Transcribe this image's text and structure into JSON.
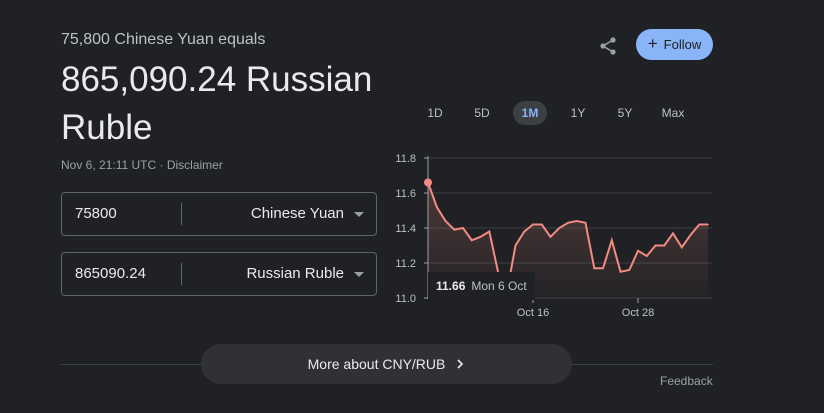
{
  "header": {
    "subtitle": "75,800 Chinese Yuan equals",
    "result": "865,090.24 Russian Ruble",
    "timestamp": "Nov 6, 21:11 UTC",
    "separator": "·",
    "disclaimer": "Disclaimer",
    "follow_label": "Follow",
    "share_icon": "share-icon",
    "follow_color": "#8ab4f8"
  },
  "converter": {
    "from": {
      "amount": "75800",
      "currency": "Chinese Yuan"
    },
    "to": {
      "amount": "865090.24",
      "currency": "Russian Ruble"
    }
  },
  "range_tabs": [
    {
      "label": "1D",
      "active": false
    },
    {
      "label": "5D",
      "active": false
    },
    {
      "label": "1M",
      "active": true
    },
    {
      "label": "1Y",
      "active": false
    },
    {
      "label": "5Y",
      "active": false
    },
    {
      "label": "Max",
      "active": false
    }
  ],
  "tooltip": {
    "value": "11.66",
    "date": "Mon 6 Oct"
  },
  "chart_data": {
    "type": "line",
    "ylabels": [
      "11.8",
      "11.6",
      "11.4",
      "11.2",
      "11.0"
    ],
    "yticks": [
      11.8,
      11.6,
      11.4,
      11.2,
      11.0
    ],
    "ylim": [
      11.0,
      11.8
    ],
    "xlabels": [
      "Oct 16",
      "Oct 28"
    ],
    "xtick_index": [
      12,
      24
    ],
    "values": [
      11.66,
      11.52,
      11.44,
      11.39,
      11.4,
      11.33,
      11.35,
      11.38,
      11.15,
      11.03,
      11.3,
      11.38,
      11.42,
      11.42,
      11.35,
      11.4,
      11.43,
      11.44,
      11.43,
      11.17,
      11.17,
      11.33,
      11.15,
      11.16,
      11.27,
      11.24,
      11.3,
      11.3,
      11.37,
      11.29,
      11.36,
      11.42,
      11.42
    ],
    "highlight_index": 0,
    "line_color": "#f28b82",
    "grid": true
  },
  "footer": {
    "more_label": "More about CNY/RUB",
    "feedback_label": "Feedback"
  }
}
